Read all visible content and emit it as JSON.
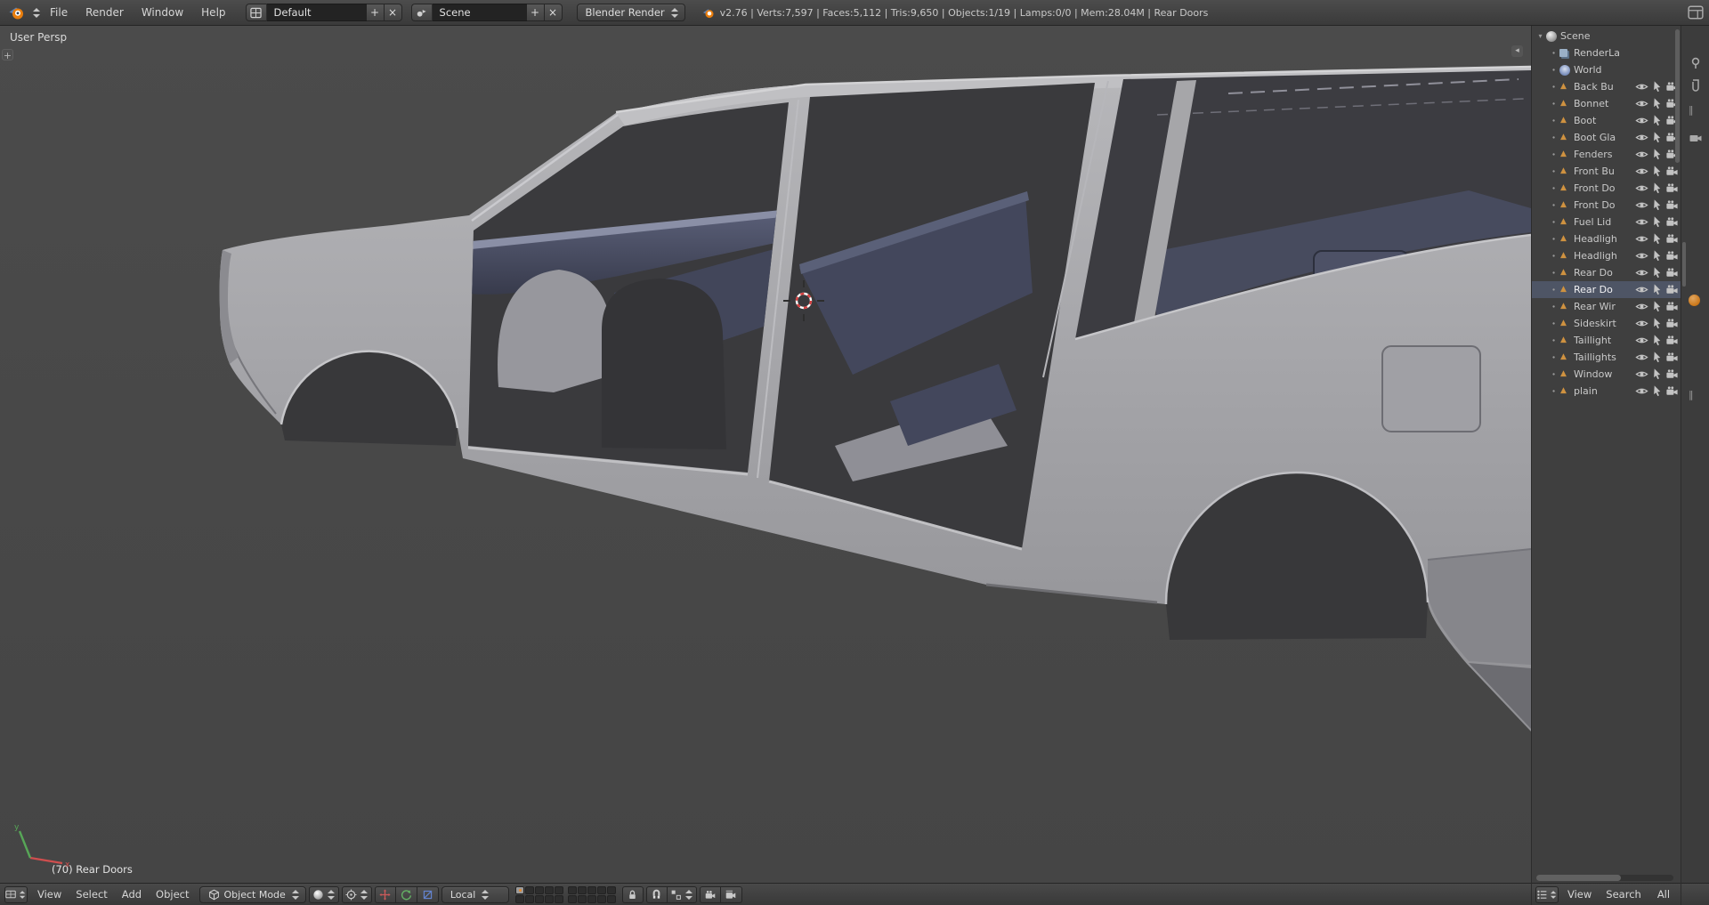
{
  "colors": {
    "accent_orange": "#e87d0d",
    "header_bg": "#3f3f3f",
    "viewport_bg": "#484848",
    "active_row_bg": "#4e5565",
    "mesh_icon": "#cf9240"
  },
  "header": {
    "menus": [
      "File",
      "Render",
      "Window",
      "Help"
    ],
    "layout_name": "Default",
    "scene_name": "Scene",
    "engine": "Blender Render",
    "stats": "v2.76 | Verts:7,597 | Faces:5,112 | Tris:9,650 | Objects:1/19 | Lamps:0/0 | Mem:28.04M | Rear Doors"
  },
  "viewport": {
    "view_label": "User Persp",
    "active_object": "(70) Rear Doors"
  },
  "view3d_header": {
    "menus": [
      "View",
      "Select",
      "Add",
      "Object"
    ],
    "mode": "Object Mode",
    "orientation": "Local",
    "layers": {
      "groups": 2,
      "rows": 2,
      "cols": 5,
      "active": [
        0
      ]
    }
  },
  "outliner": {
    "items": [
      {
        "label": "Scene",
        "icon": "scene",
        "type": "scene",
        "expanded": true
      },
      {
        "label": "RenderLa",
        "icon": "renderlayers",
        "type": "data"
      },
      {
        "label": "World",
        "icon": "world",
        "type": "data"
      },
      {
        "label": "Back Bu",
        "icon": "mesh",
        "type": "object"
      },
      {
        "label": "Bonnet",
        "icon": "mesh",
        "type": "object"
      },
      {
        "label": "Boot",
        "icon": "mesh",
        "type": "object"
      },
      {
        "label": "Boot Gla",
        "icon": "mesh",
        "type": "object"
      },
      {
        "label": "Fenders",
        "icon": "mesh",
        "type": "object"
      },
      {
        "label": "Front Bu",
        "icon": "mesh",
        "type": "object"
      },
      {
        "label": "Front Do",
        "icon": "mesh",
        "type": "object"
      },
      {
        "label": "Front Do",
        "icon": "mesh",
        "type": "object"
      },
      {
        "label": "Fuel Lid",
        "icon": "mesh",
        "type": "object"
      },
      {
        "label": "Headligh",
        "icon": "mesh",
        "type": "object"
      },
      {
        "label": "Headligh",
        "icon": "mesh",
        "type": "object"
      },
      {
        "label": "Rear Do",
        "icon": "mesh",
        "type": "object"
      },
      {
        "label": "Rear Do",
        "icon": "mesh",
        "type": "object",
        "active": true
      },
      {
        "label": "Rear Wir",
        "icon": "mesh",
        "type": "object"
      },
      {
        "label": "Sideskirt",
        "icon": "mesh",
        "type": "object"
      },
      {
        "label": "Taillight",
        "icon": "mesh",
        "type": "object"
      },
      {
        "label": "Taillights",
        "icon": "mesh",
        "type": "object"
      },
      {
        "label": "Window",
        "icon": "mesh",
        "type": "object"
      },
      {
        "label": "plain",
        "icon": "mesh",
        "type": "object"
      }
    ],
    "toggle_icons": [
      "visibility-eye",
      "selectability-cursor",
      "renderability-camera"
    ],
    "header": {
      "menus": [
        "View",
        "Search"
      ],
      "display_mode": "All"
    }
  },
  "properties_panel": {
    "tab_icons": [
      "pin",
      "paperclip",
      "grip-bars",
      "camera",
      "material-sphere",
      "grip-bars"
    ]
  }
}
